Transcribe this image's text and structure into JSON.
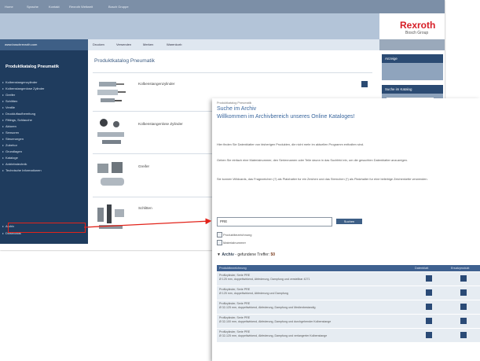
{
  "back_window": {
    "topnav_items": [
      "Home",
      "Sprache",
      "Kontakt",
      "Rexroth Weltweit",
      "Bosch Gruppe"
    ],
    "logo_brand": "Rexroth",
    "logo_sub": "Bosch Group",
    "url": "www.boschrexroth.com",
    "toolbar": [
      "Drucken",
      "Versenden",
      "Merken",
      "Warenkorb"
    ],
    "sidebar_title": "Produktkatalog Pneumatik",
    "sidebar_items": [
      "Kolbenstangenzylinder",
      "Kolbenstangenlose Zylinder",
      "Greifer",
      "Schlitten",
      "Ventile",
      "Druckluftaufbereitung",
      "Fittings, Schlauche",
      "Aktoren",
      "Sensoren",
      "Steuerungen",
      "Zubehor",
      "Grundlagen",
      "Kataloge",
      "Antriebstechnik",
      "Technische Informationen",
      "Archiv",
      "Downloads"
    ],
    "page_title": "Produktkatalog Pneumatik",
    "products": [
      "Kolbenstangenzylinder",
      "Kolbenstangenlose Zylinder",
      "Greifer",
      "Schlitten"
    ],
    "right_col": {
      "header1": "Anzeige",
      "header2": "Suche im Katalog"
    }
  },
  "front_window": {
    "breadcrumb": "Produktkatalog Pneumatik",
    "heading1": "Suche im Archiv",
    "heading2": "Willkommen im Archivbereich unseres Online Kataloges!",
    "paragraphs": [
      "Hier finden Sie Datenblatter von bisherigen Produkten, die nicht mehr im aktuellen Programm enthalten sind.",
      "Geben Sie einfach eine Materialnummer, den Seriennamen oder Teile davon in das Suchfeld ein, um die gesuchten Datenblatter anzuzeigen.",
      "Sie konnen Wildcards, das Fragezeichen (?) als Platzhalter fur ein Zeichen und das Sternchen (*) als Platzhalter fur eine beliebige Zeichenkette verwenden."
    ],
    "search_value": "PRE",
    "search_button": "Suchen",
    "checkboxes": [
      "Produktbezeichnung",
      "Materialnummer"
    ],
    "archive_label": "Archiv",
    "archive_suffix": "- gefundene Treffer:",
    "archive_count": "50",
    "table_headers": [
      "Produktbezeichnung",
      "Datenblatt",
      "Ersatzprodukt"
    ],
    "rows": [
      "Profilzylinder, Serie PRE\nØ 125 mm, doppeltwirkend, Abfederung, Dampfung und verstellbar 4271",
      "Profilzylinder, Serie PRE\nØ 125 mm, doppeltwirkend, Abfederung und Dampfung",
      "Profilzylinder, Serie PRE\nØ 32-125 mm, doppeltwirkend, Abfederung, Dampfung und Medienbestandig",
      "Profilzylinder, Serie PRE\nØ 32-100 mm, doppeltwirkend, Abfederung, Dampfung und durchgehender Kolbenstange",
      "Profilzylinder, Serie PRE\nØ 32-125 mm, doppeltwirkend, Abfederung, Dampfung und verlangerter Kolbenstange"
    ]
  },
  "colors": {
    "annotation_red": "#e2231a",
    "brand_red": "#d61d26",
    "nav_blue": "#1f3c5e"
  }
}
